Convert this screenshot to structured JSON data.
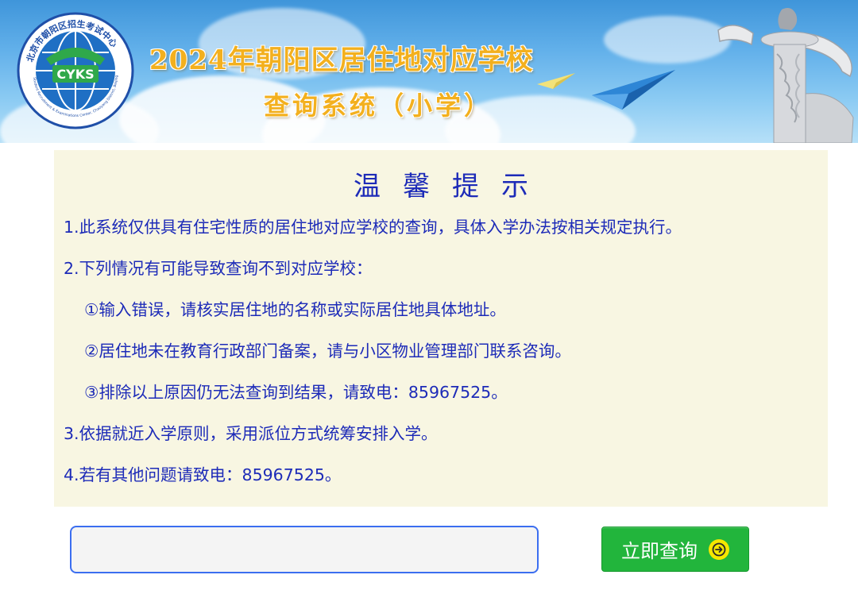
{
  "banner": {
    "logo_text": "CYKS",
    "logo_ring_text": "北京市朝阳区招生考试中心",
    "logo_english_text": "Student Recruitment & Examinations Center, Chaoyang District, Beijing",
    "title_line1": "2024年朝阳区居住地对应学校",
    "title_line2": "查询系统（小学）"
  },
  "notice": {
    "title": "温馨提示",
    "items": [
      "1.此系统仅供具有住宅性质的居住地对应学校的查询，具体入学办法按相关规定执行。",
      "2.下列情况有可能导致查询不到对应学校：",
      "①输入错误，请核实居住地的名称或实际居住地具体地址。",
      "②居住地未在教育行政部门备案，请与小区物业管理部门联系咨询。",
      "③排除以上原因仍无法查询到结果，请致电：85967525。",
      "3.依据就近入学原则，采用派位方式统筹安排入学。",
      "4.若有其他问题请致电：85967525。"
    ]
  },
  "search": {
    "value": "",
    "placeholder": "",
    "button_label": "立即查询",
    "button_icon": "arrow-right-circle-icon"
  },
  "colors": {
    "notice_text": "#1d2bb8",
    "notice_bg": "#f8f6e2",
    "button_bg": "#22b53c",
    "input_border": "#3b6ef0",
    "title_gold": "#f3b01e"
  }
}
